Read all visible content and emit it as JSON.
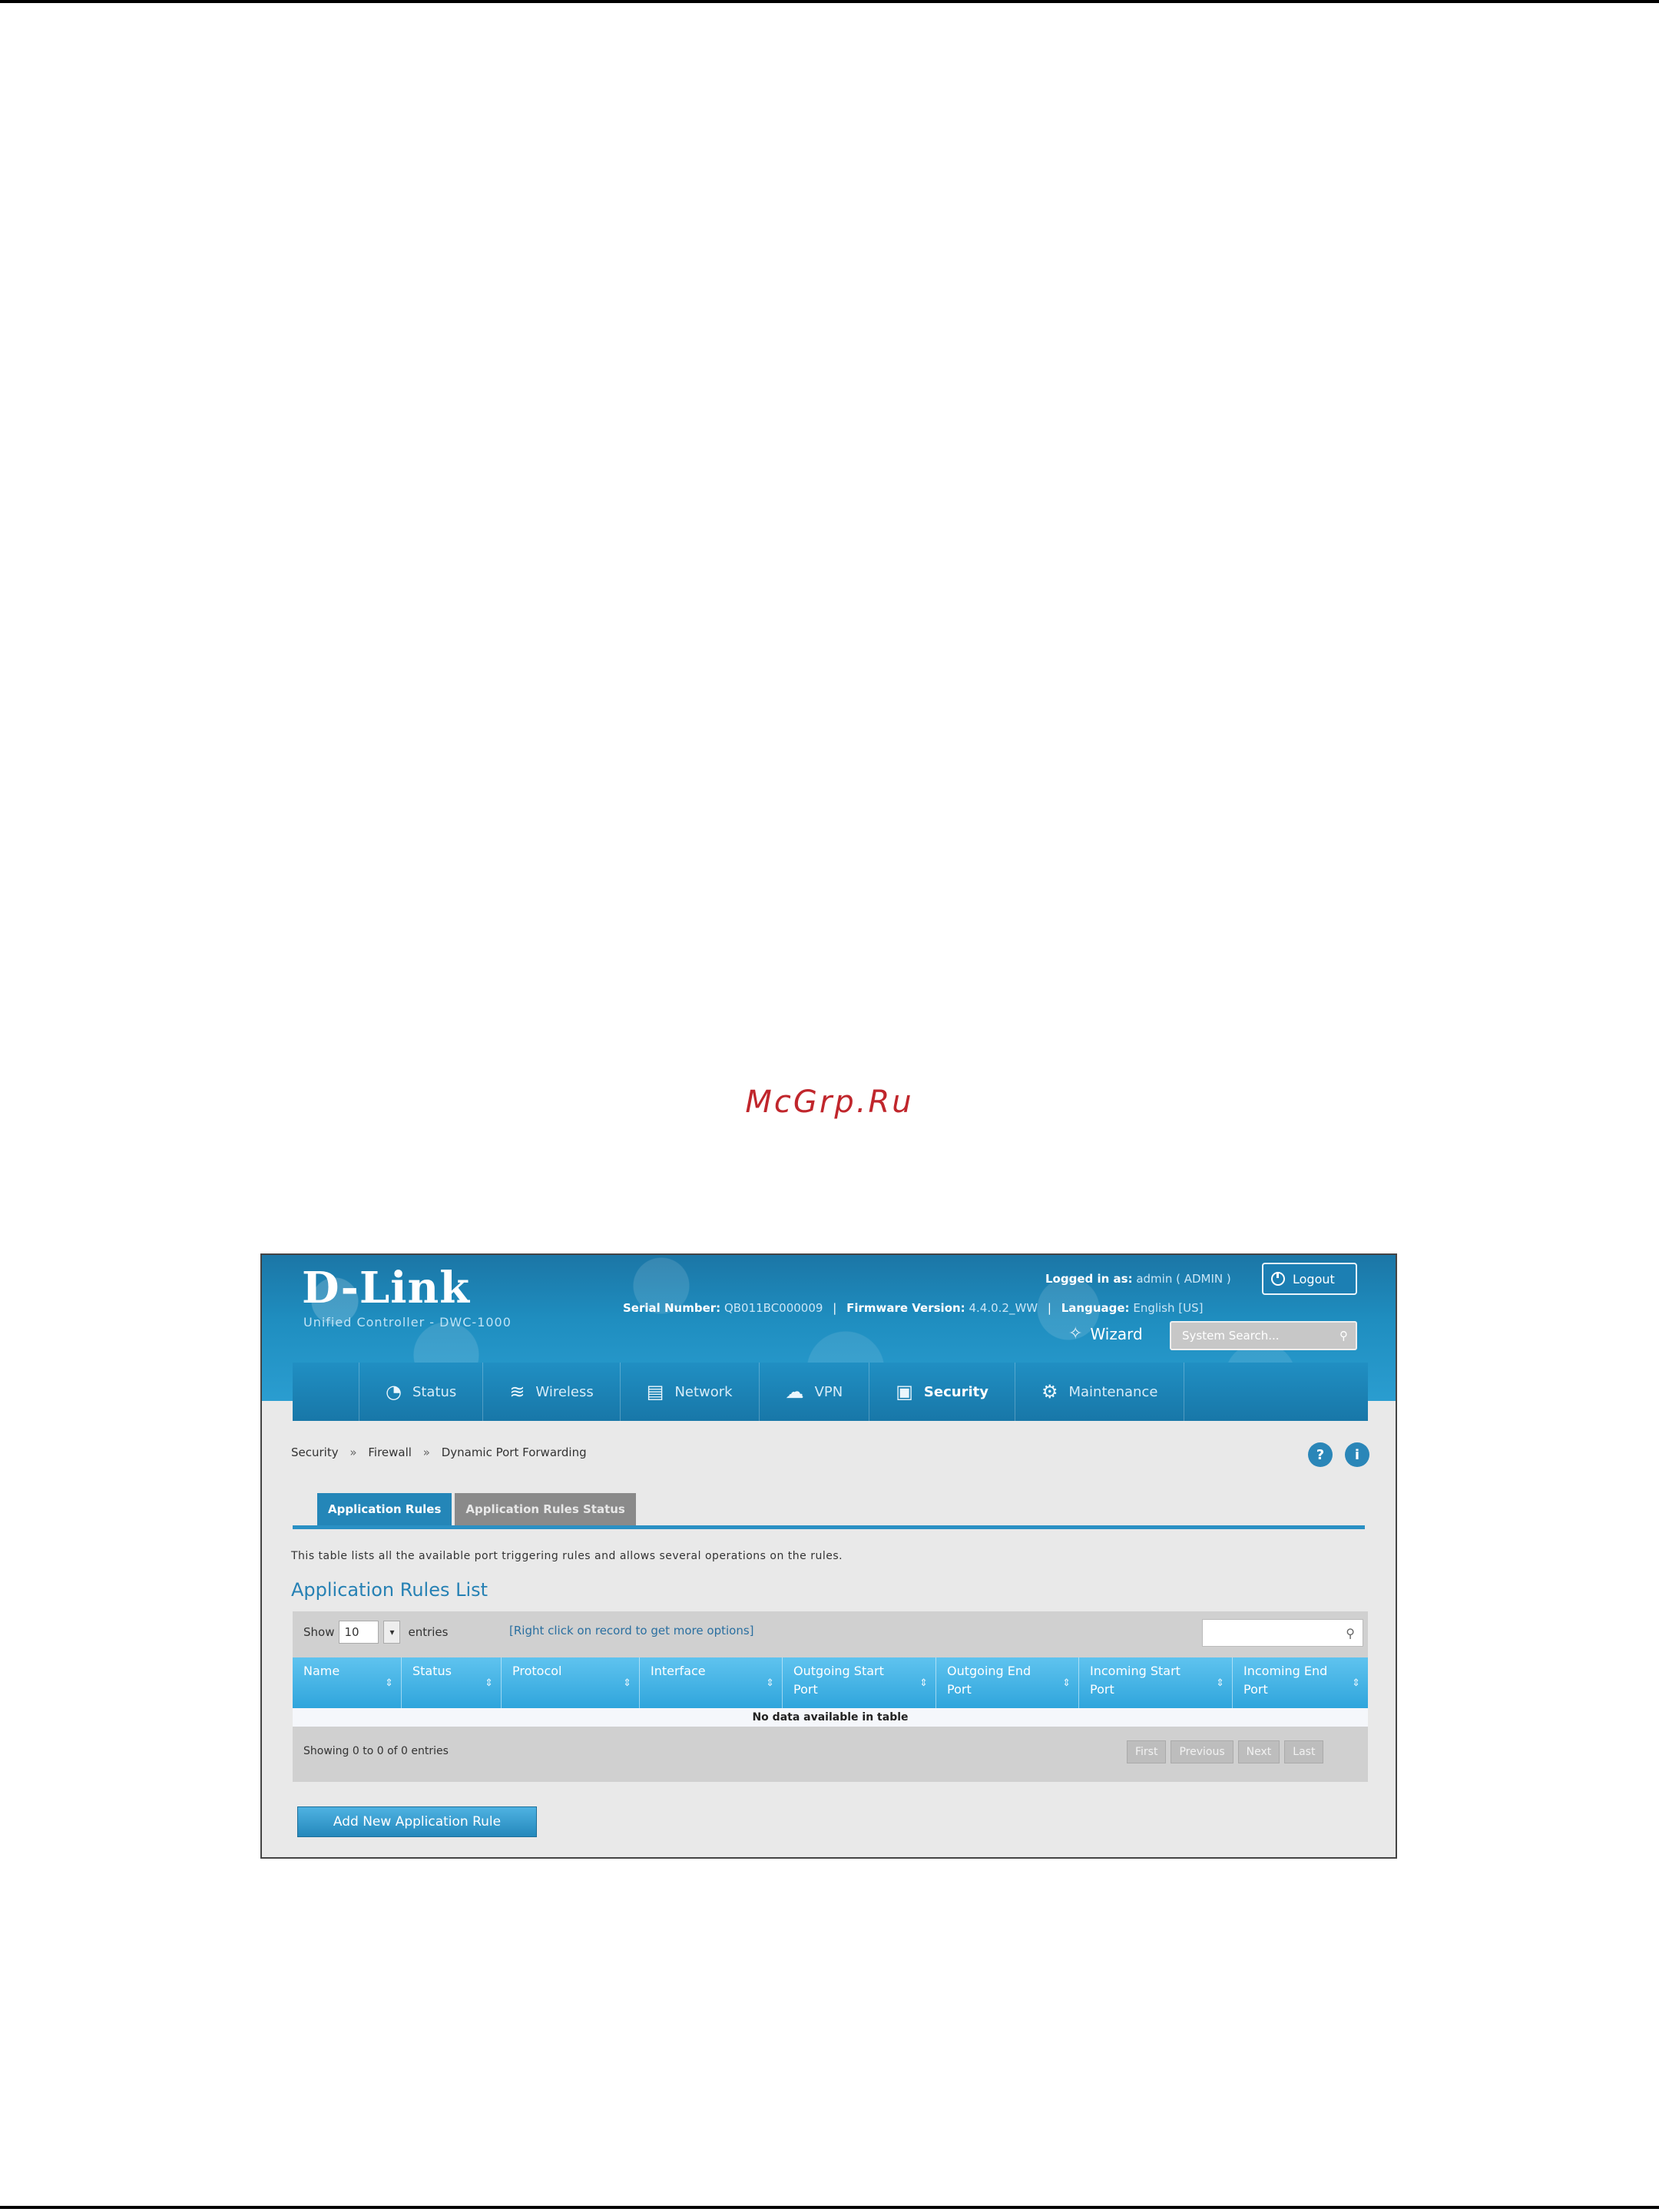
{
  "page": {
    "watermark": "McGrp.Ru"
  },
  "header": {
    "logo": "D-Link",
    "subtitle": "Unified Controller - DWC-1000",
    "serial_label": "Serial Number:",
    "serial_value": "QB011BC000009",
    "firmware_label": "Firmware Version:",
    "firmware_value": "4.4.0.2_WW",
    "language_label": "Language:",
    "language_value": "English [US]",
    "logged_label": "Logged in as:",
    "logged_value": "admin ( ADMIN )",
    "logout_label": "Logout",
    "wizard_label": "Wizard",
    "search_placeholder": "System Search..."
  },
  "nav": {
    "items": [
      {
        "label": "Status",
        "icon": "gauge-icon"
      },
      {
        "label": "Wireless",
        "icon": "wifi-icon"
      },
      {
        "label": "Network",
        "icon": "server-icon"
      },
      {
        "label": "VPN",
        "icon": "cloud-icon"
      },
      {
        "label": "Security",
        "icon": "lock-icon",
        "active": true
      },
      {
        "label": "Maintenance",
        "icon": "gears-icon"
      }
    ]
  },
  "breadcrumb": {
    "items": [
      "Security",
      "Firewall",
      "Dynamic Port Forwarding"
    ],
    "separator": "»"
  },
  "tabs": [
    {
      "label": "Application Rules",
      "active": true
    },
    {
      "label": "Application Rules Status",
      "active": false
    }
  ],
  "description": "This table lists all the available port triggering rules and allows several operations on the rules.",
  "list_title": "Application Rules List",
  "table": {
    "show_label": "Show",
    "show_value": "10",
    "entries_label": "entries",
    "hint": "[Right click on record to get more options]",
    "columns": [
      "Name",
      "Status",
      "Protocol",
      "Interface",
      "Outgoing Start Port",
      "Outgoing End Port",
      "Incoming Start Port",
      "Incoming End Port"
    ],
    "empty_message": "No data available in table",
    "info": "Showing 0 to 0 of 0 entries",
    "pager": [
      "First",
      "Previous",
      "Next",
      "Last"
    ]
  },
  "add_button": "Add New Application Rule"
}
